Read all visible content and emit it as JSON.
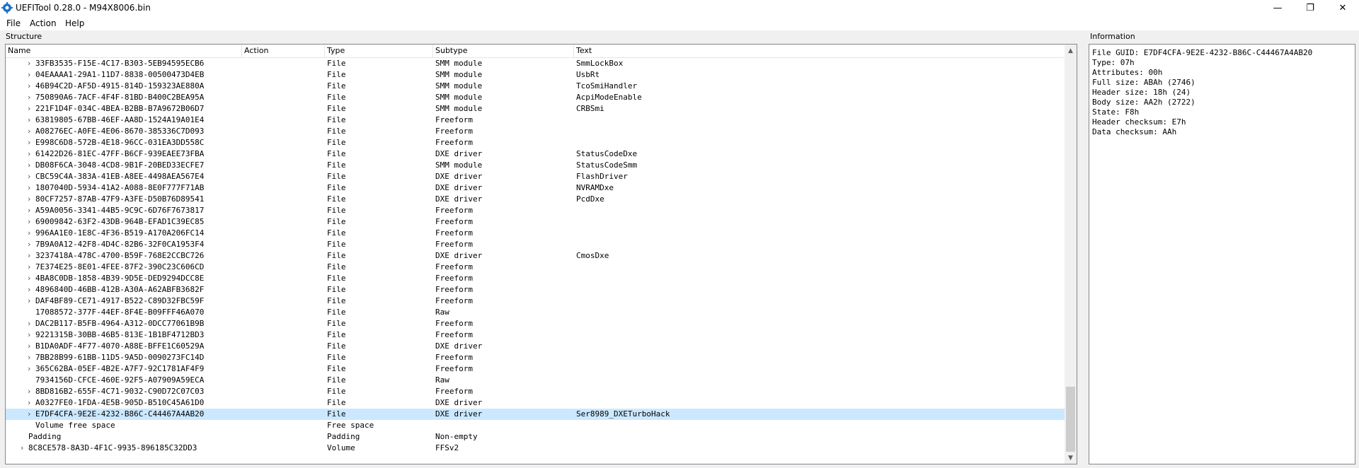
{
  "window": {
    "title": "UEFITool 0.28.0 - M94X8006.bin",
    "controls": {
      "minimize": "—",
      "maximize": "❐",
      "close": "✕"
    }
  },
  "menu": {
    "items": [
      "File",
      "Action",
      "Help"
    ]
  },
  "structure": {
    "label": "Structure",
    "columns": [
      "Name",
      "Action",
      "Type",
      "Subtype",
      "Text"
    ],
    "rows": [
      {
        "name": "33FB3535-F15E-4C17-B303-5EB94595ECB6",
        "type": "File",
        "subtype": "SMM module",
        "text": "SmmLockBox",
        "expand": true,
        "indent": 1
      },
      {
        "name": "04EAAAA1-29A1-11D7-8838-00500473D4EB",
        "type": "File",
        "subtype": "SMM module",
        "text": "UsbRt",
        "expand": true,
        "indent": 1
      },
      {
        "name": "46B94C2D-AF5D-4915-814D-159323AE880A",
        "type": "File",
        "subtype": "SMM module",
        "text": "TcoSmiHandler",
        "expand": true,
        "indent": 1
      },
      {
        "name": "750890A6-7ACF-4F4F-81BD-B400C2BEA95A",
        "type": "File",
        "subtype": "SMM module",
        "text": "AcpiModeEnable",
        "expand": true,
        "indent": 1
      },
      {
        "name": "221F1D4F-034C-4BEA-B2BB-B7A9672B06D7",
        "type": "File",
        "subtype": "SMM module",
        "text": "CRBSmi",
        "expand": true,
        "indent": 1
      },
      {
        "name": "63819805-67BB-46EF-AA8D-1524A19A01E4",
        "type": "File",
        "subtype": "Freeform",
        "text": "",
        "expand": true,
        "indent": 1
      },
      {
        "name": "A08276EC-A0FE-4E06-8670-385336C7D093",
        "type": "File",
        "subtype": "Freeform",
        "text": "",
        "expand": true,
        "indent": 1
      },
      {
        "name": "E998C6D8-572B-4E18-96CC-031EA3DD558C",
        "type": "File",
        "subtype": "Freeform",
        "text": "",
        "expand": true,
        "indent": 1
      },
      {
        "name": "61422D26-81EC-47FF-B6CF-939EAEE73FBA",
        "type": "File",
        "subtype": "DXE driver",
        "text": "StatusCodeDxe",
        "expand": true,
        "indent": 1
      },
      {
        "name": "DB08F6CA-3048-4CD8-9B1F-20BED33ECFE7",
        "type": "File",
        "subtype": "SMM module",
        "text": "StatusCodeSmm",
        "expand": true,
        "indent": 1
      },
      {
        "name": "CBC59C4A-383A-41EB-A8EE-4498AEA567E4",
        "type": "File",
        "subtype": "DXE driver",
        "text": "FlashDriver",
        "expand": true,
        "indent": 1
      },
      {
        "name": "1807040D-5934-41A2-A088-8E0F777F71AB",
        "type": "File",
        "subtype": "DXE driver",
        "text": "NVRAMDxe",
        "expand": true,
        "indent": 1
      },
      {
        "name": "80CF7257-87AB-47F9-A3FE-D50B76D89541",
        "type": "File",
        "subtype": "DXE driver",
        "text": "PcdDxe",
        "expand": true,
        "indent": 1
      },
      {
        "name": "A59A0056-3341-44B5-9C9C-6D76F7673817",
        "type": "File",
        "subtype": "Freeform",
        "text": "",
        "expand": true,
        "indent": 1
      },
      {
        "name": "69009842-63F2-43DB-964B-EFAD1C39EC85",
        "type": "File",
        "subtype": "Freeform",
        "text": "",
        "expand": true,
        "indent": 1
      },
      {
        "name": "996AA1E0-1E8C-4F36-B519-A170A206FC14",
        "type": "File",
        "subtype": "Freeform",
        "text": "",
        "expand": true,
        "indent": 1
      },
      {
        "name": "7B9A0A12-42F8-4D4C-82B6-32F0CA1953F4",
        "type": "File",
        "subtype": "Freeform",
        "text": "",
        "expand": true,
        "indent": 1
      },
      {
        "name": "3237418A-478C-4700-B59F-768E2CCBC726",
        "type": "File",
        "subtype": "DXE driver",
        "text": "CmosDxe",
        "expand": true,
        "indent": 1
      },
      {
        "name": "7E374E25-8E01-4FEE-87F2-390C23C606CD",
        "type": "File",
        "subtype": "Freeform",
        "text": "",
        "expand": true,
        "indent": 1
      },
      {
        "name": "4BA8C0DB-1858-4B39-9D5E-DED9294DCC8E",
        "type": "File",
        "subtype": "Freeform",
        "text": "",
        "expand": true,
        "indent": 1
      },
      {
        "name": "4896840D-46BB-412B-A30A-A62ABFB3682F",
        "type": "File",
        "subtype": "Freeform",
        "text": "",
        "expand": true,
        "indent": 1
      },
      {
        "name": "DAF4BF89-CE71-4917-B522-C89D32FBC59F",
        "type": "File",
        "subtype": "Freeform",
        "text": "",
        "expand": true,
        "indent": 1
      },
      {
        "name": "17088572-377F-44EF-8F4E-B09FFF46A070",
        "type": "File",
        "subtype": "Raw",
        "text": "",
        "expand": false,
        "indent": 1
      },
      {
        "name": "DAC2B117-B5FB-4964-A312-0DCC77061B9B",
        "type": "File",
        "subtype": "Freeform",
        "text": "",
        "expand": true,
        "indent": 1
      },
      {
        "name": "9221315B-30BB-46B5-813E-1B1BF4712BD3",
        "type": "File",
        "subtype": "Freeform",
        "text": "",
        "expand": true,
        "indent": 1
      },
      {
        "name": "B1DA0ADF-4F77-4070-A88E-BFFE1C60529A",
        "type": "File",
        "subtype": "DXE driver",
        "text": "",
        "expand": true,
        "indent": 1
      },
      {
        "name": "7BB28B99-61BB-11D5-9A5D-0090273FC14D",
        "type": "File",
        "subtype": "Freeform",
        "text": "",
        "expand": true,
        "indent": 1
      },
      {
        "name": "365C62BA-05EF-4B2E-A7F7-92C1781AF4F9",
        "type": "File",
        "subtype": "Freeform",
        "text": "",
        "expand": true,
        "indent": 1
      },
      {
        "name": "7934156D-CFCE-460E-92F5-A07909A59ECA",
        "type": "File",
        "subtype": "Raw",
        "text": "",
        "expand": false,
        "indent": 1
      },
      {
        "name": "8BD816B2-655F-4C71-9032-C90D72C07C03",
        "type": "File",
        "subtype": "Freeform",
        "text": "",
        "expand": true,
        "indent": 1
      },
      {
        "name": "A0327FE0-1FDA-4E5B-905D-B510C45A61D0",
        "type": "File",
        "subtype": "DXE driver",
        "text": "",
        "expand": true,
        "indent": 1
      },
      {
        "name": "E7DF4CFA-9E2E-4232-B86C-C44467A4AB20",
        "type": "File",
        "subtype": "DXE driver",
        "text": "Ser8989_DXETurboHack",
        "expand": true,
        "indent": 1,
        "selected": true
      },
      {
        "name": "Volume free space",
        "type": "Free space",
        "subtype": "",
        "text": "",
        "expand": false,
        "indent": 1
      },
      {
        "name": "Padding",
        "type": "Padding",
        "subtype": "Non-empty",
        "text": "",
        "expand": false,
        "indent": 0
      },
      {
        "name": "8C8CE578-8A3D-4F1C-9935-896185C32DD3",
        "type": "Volume",
        "subtype": "FFSv2",
        "text": "",
        "expand": true,
        "indent": 0
      }
    ]
  },
  "information": {
    "label": "Information",
    "lines": [
      "File GUID: E7DF4CFA-9E2E-4232-B86C-C44467A4AB20",
      "Type: 07h",
      "Attributes: 00h",
      "Full size: ABAh (2746)",
      "Header size: 18h (24)",
      "Body size: AA2h (2722)",
      "State: F8h",
      "Header checksum: E7h",
      "Data checksum: AAh"
    ]
  },
  "colors": {
    "selection": "#cce8ff",
    "panel_border": "#828790"
  }
}
